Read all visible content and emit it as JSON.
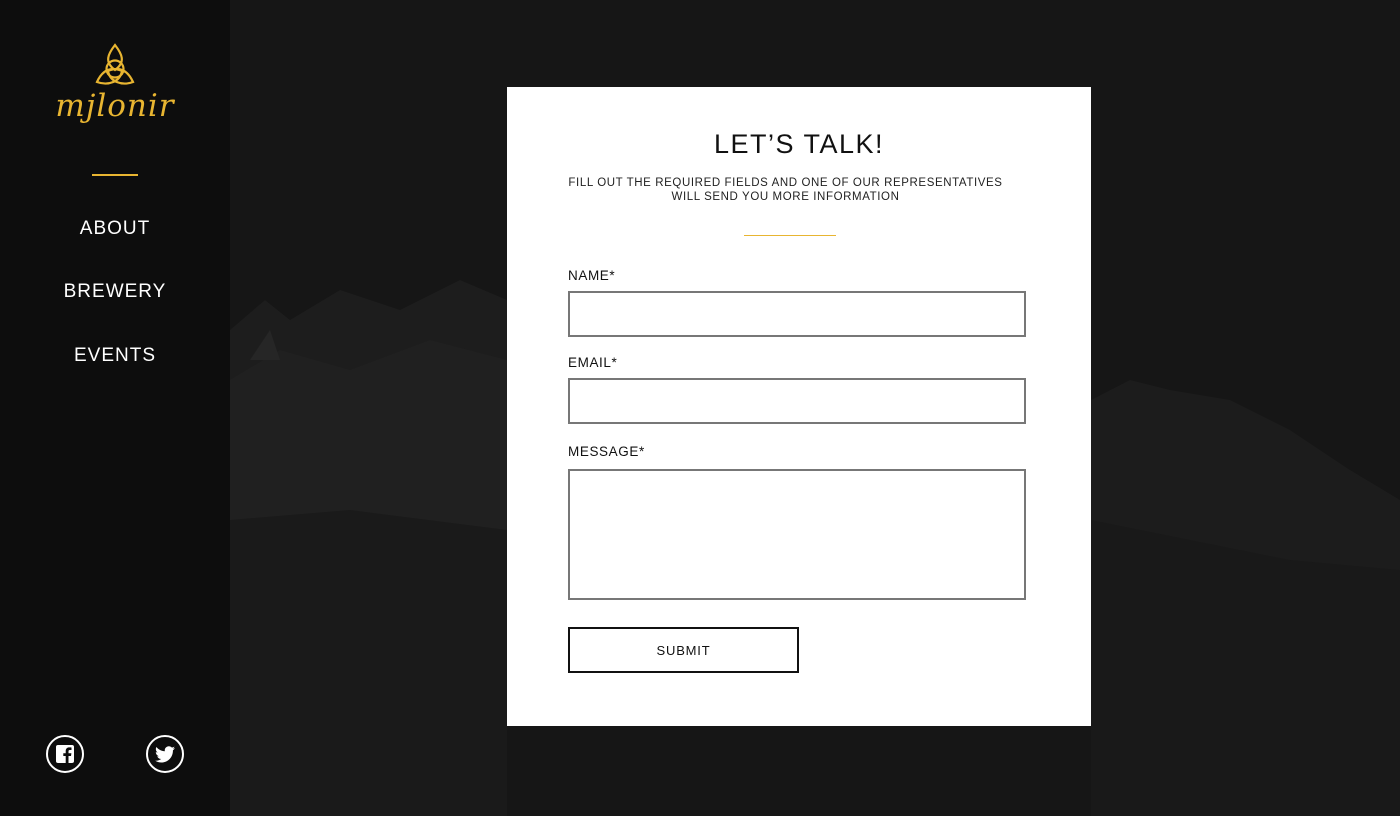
{
  "brand": {
    "name": "mjlonir",
    "accent_color": "#e8b531"
  },
  "nav": {
    "items": [
      {
        "label": "ABOUT"
      },
      {
        "label": "BREWERY"
      },
      {
        "label": "EVENTS"
      }
    ]
  },
  "social": {
    "icons": [
      "facebook-icon",
      "twitter-icon"
    ]
  },
  "form": {
    "title": "LET’S TALK!",
    "subtitle_line1": "FILL OUT THE REQUIRED FIELDS AND ONE OF OUR REPRESENTATIVES",
    "subtitle_line2": "WILL SEND YOU MORE INFORMATION",
    "name_label": "NAME*",
    "name_value": "",
    "email_label": "EMAIL*",
    "email_value": "",
    "message_label": "MESSAGE*",
    "message_value": "",
    "submit_label": "SUBMIT"
  }
}
